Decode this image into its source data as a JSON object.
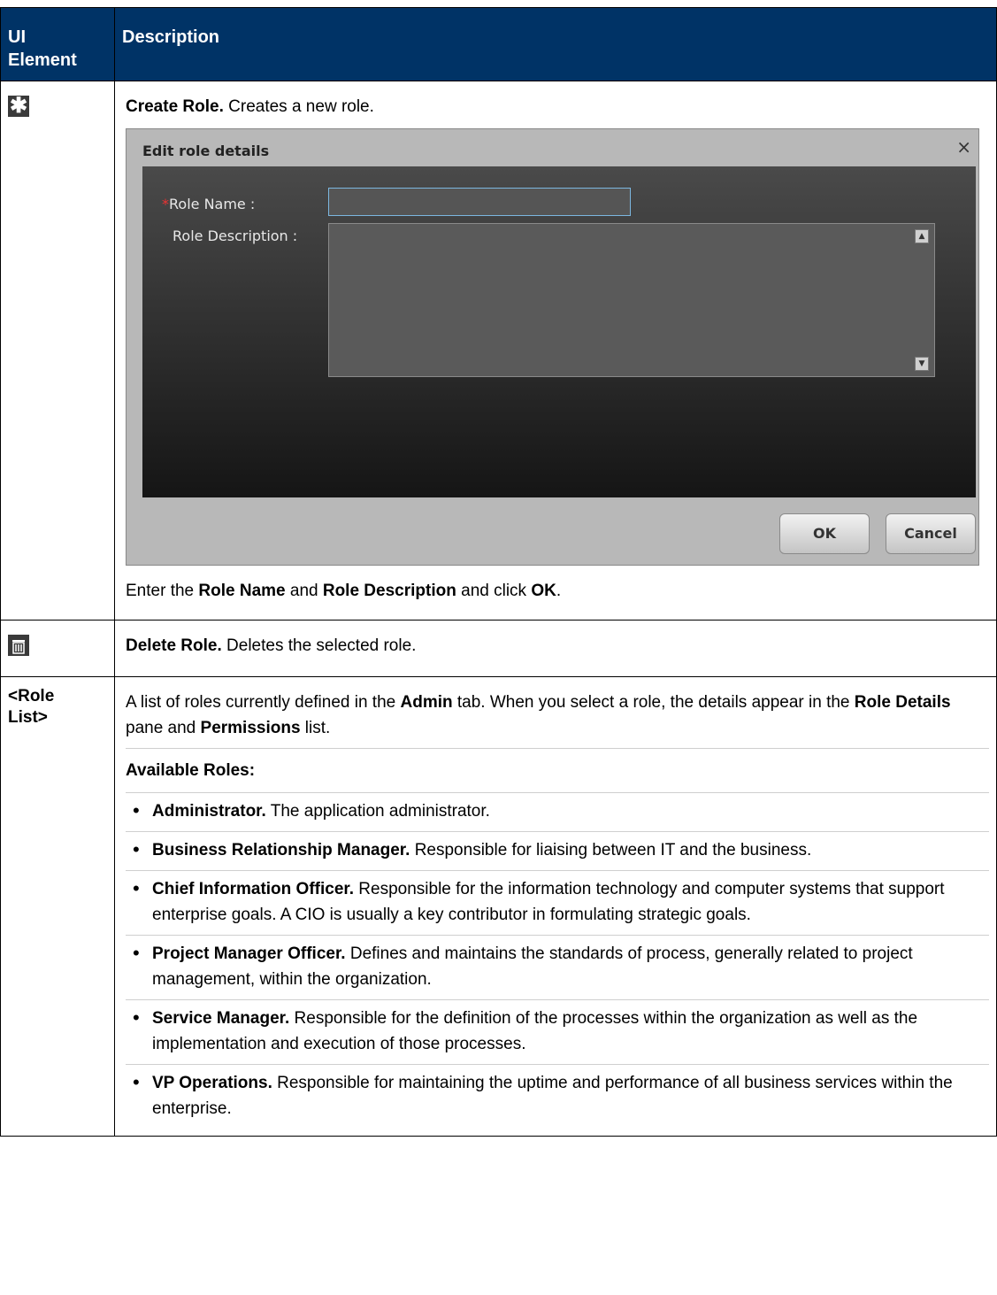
{
  "table": {
    "header": {
      "col1": "UI Element",
      "col1_line1": "UI",
      "col1_line2": "Element",
      "col2": "Description"
    },
    "rows": [
      {
        "icon": "asterisk-icon",
        "title": "Create Role.",
        "text": " Creates a new role.",
        "dialog": {
          "title": "Edit role details",
          "close_glyph": "×",
          "role_name_label": "Role Name :",
          "required_mark": "*",
          "role_name_value": "",
          "role_description_label": "Role Description :",
          "ok_label": "OK",
          "cancel_label": "Cancel"
        },
        "after": {
          "t1": "Enter the ",
          "b1": "Role Name",
          "t2": " and ",
          "b2": "Role Description",
          "t3": " and click ",
          "b3": "OK",
          "t4": "."
        }
      },
      {
        "icon": "trash-icon",
        "title": "Delete Role.",
        "text": " Deletes the selected role."
      },
      {
        "element": "<Role List>",
        "element_line1": "<Role",
        "element_line2": "List>",
        "intro": {
          "t1": "A list of roles currently defined in the ",
          "b1": "Admin",
          "t2": " tab. When you select a role, the details appear in the ",
          "b2": "Role Details",
          "t3": " pane and ",
          "b3": "Permissions",
          "t4": " list."
        },
        "available_label": "Available Roles:",
        "roles": [
          {
            "name": "Administrator.",
            "desc": " The application administrator."
          },
          {
            "name": "Business Relationship Manager.",
            "desc": " Responsible for liaising between IT and the business."
          },
          {
            "name": "Chief Information Officer.",
            "desc": " Responsible for the information technology and computer systems that support enterprise goals. A CIO is usually a key contributor in formulating strategic goals."
          },
          {
            "name": "Project Manager Officer.",
            "desc": " Defines and maintains the standards of process, generally related to project management, within the organization."
          },
          {
            "name": "Service Manager.",
            "desc": " Responsible for the definition of the processes within the organization as well as the implementation and execution of those processes."
          },
          {
            "name": "VP Operations.",
            "desc": " Responsible for maintaining the uptime and performance of all business services within the enterprise."
          }
        ]
      }
    ]
  },
  "colors": {
    "header_bg": "#003366",
    "header_text": "#ffffff",
    "required_mark": "#ee3333"
  }
}
